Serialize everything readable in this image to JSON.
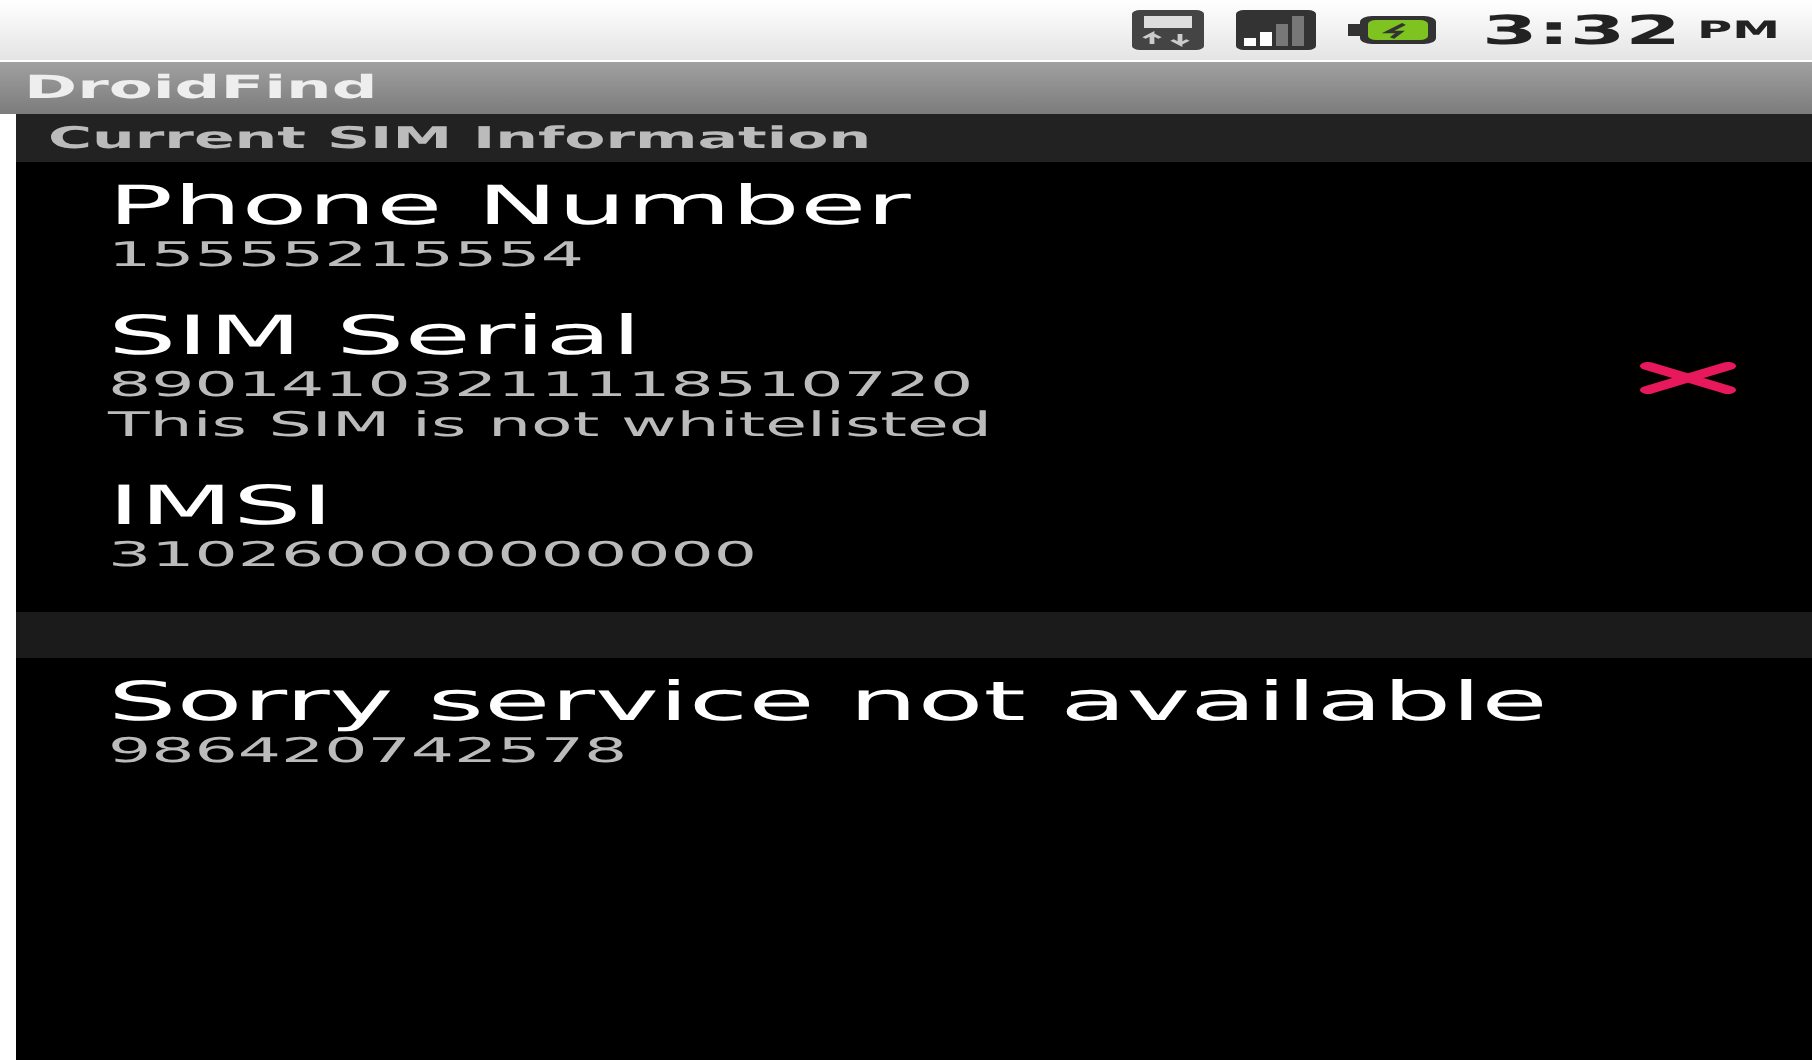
{
  "status_bar": {
    "time": "3:32",
    "meridiem": "PM"
  },
  "app_title": "DroidFind",
  "section_header": "Current SIM Information",
  "sim_items": [
    {
      "title": "Phone Number",
      "value": "15555215554",
      "flagged": false
    },
    {
      "title": "SIM Serial",
      "value": "89014103211118510720",
      "note": "This SIM is not whitelisted",
      "flagged": true
    },
    {
      "title": "IMSI",
      "value": "310260000000000",
      "flagged": false
    }
  ],
  "service_items": [
    {
      "title": "Sorry service not available",
      "value": "986420742578"
    }
  ]
}
